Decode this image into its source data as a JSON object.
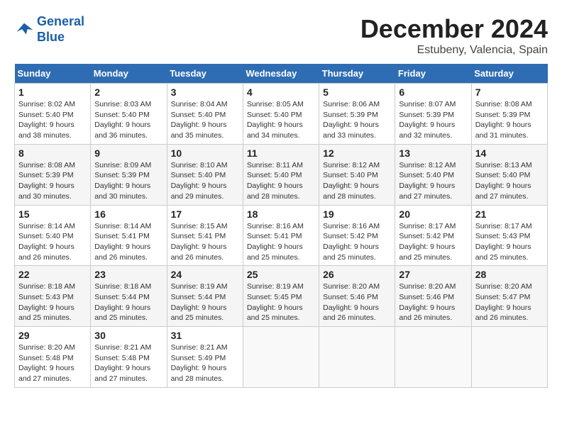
{
  "header": {
    "logo_line1": "General",
    "logo_line2": "Blue",
    "month": "December 2024",
    "location": "Estubeny, Valencia, Spain"
  },
  "days_of_week": [
    "Sunday",
    "Monday",
    "Tuesday",
    "Wednesday",
    "Thursday",
    "Friday",
    "Saturday"
  ],
  "weeks": [
    [
      {
        "day": 1,
        "sunrise": "8:02 AM",
        "sunset": "5:40 PM",
        "daylight": "9 hours and 38 minutes."
      },
      {
        "day": 2,
        "sunrise": "8:03 AM",
        "sunset": "5:40 PM",
        "daylight": "9 hours and 36 minutes."
      },
      {
        "day": 3,
        "sunrise": "8:04 AM",
        "sunset": "5:40 PM",
        "daylight": "9 hours and 35 minutes."
      },
      {
        "day": 4,
        "sunrise": "8:05 AM",
        "sunset": "5:40 PM",
        "daylight": "9 hours and 34 minutes."
      },
      {
        "day": 5,
        "sunrise": "8:06 AM",
        "sunset": "5:39 PM",
        "daylight": "9 hours and 33 minutes."
      },
      {
        "day": 6,
        "sunrise": "8:07 AM",
        "sunset": "5:39 PM",
        "daylight": "9 hours and 32 minutes."
      },
      {
        "day": 7,
        "sunrise": "8:08 AM",
        "sunset": "5:39 PM",
        "daylight": "9 hours and 31 minutes."
      }
    ],
    [
      {
        "day": 8,
        "sunrise": "8:08 AM",
        "sunset": "5:39 PM",
        "daylight": "9 hours and 30 minutes."
      },
      {
        "day": 9,
        "sunrise": "8:09 AM",
        "sunset": "5:39 PM",
        "daylight": "9 hours and 30 minutes."
      },
      {
        "day": 10,
        "sunrise": "8:10 AM",
        "sunset": "5:40 PM",
        "daylight": "9 hours and 29 minutes."
      },
      {
        "day": 11,
        "sunrise": "8:11 AM",
        "sunset": "5:40 PM",
        "daylight": "9 hours and 28 minutes."
      },
      {
        "day": 12,
        "sunrise": "8:12 AM",
        "sunset": "5:40 PM",
        "daylight": "9 hours and 28 minutes."
      },
      {
        "day": 13,
        "sunrise": "8:12 AM",
        "sunset": "5:40 PM",
        "daylight": "9 hours and 27 minutes."
      },
      {
        "day": 14,
        "sunrise": "8:13 AM",
        "sunset": "5:40 PM",
        "daylight": "9 hours and 27 minutes."
      }
    ],
    [
      {
        "day": 15,
        "sunrise": "8:14 AM",
        "sunset": "5:40 PM",
        "daylight": "9 hours and 26 minutes."
      },
      {
        "day": 16,
        "sunrise": "8:14 AM",
        "sunset": "5:41 PM",
        "daylight": "9 hours and 26 minutes."
      },
      {
        "day": 17,
        "sunrise": "8:15 AM",
        "sunset": "5:41 PM",
        "daylight": "9 hours and 26 minutes."
      },
      {
        "day": 18,
        "sunrise": "8:16 AM",
        "sunset": "5:41 PM",
        "daylight": "9 hours and 25 minutes."
      },
      {
        "day": 19,
        "sunrise": "8:16 AM",
        "sunset": "5:42 PM",
        "daylight": "9 hours and 25 minutes."
      },
      {
        "day": 20,
        "sunrise": "8:17 AM",
        "sunset": "5:42 PM",
        "daylight": "9 hours and 25 minutes."
      },
      {
        "day": 21,
        "sunrise": "8:17 AM",
        "sunset": "5:43 PM",
        "daylight": "9 hours and 25 minutes."
      }
    ],
    [
      {
        "day": 22,
        "sunrise": "8:18 AM",
        "sunset": "5:43 PM",
        "daylight": "9 hours and 25 minutes."
      },
      {
        "day": 23,
        "sunrise": "8:18 AM",
        "sunset": "5:44 PM",
        "daylight": "9 hours and 25 minutes."
      },
      {
        "day": 24,
        "sunrise": "8:19 AM",
        "sunset": "5:44 PM",
        "daylight": "9 hours and 25 minutes."
      },
      {
        "day": 25,
        "sunrise": "8:19 AM",
        "sunset": "5:45 PM",
        "daylight": "9 hours and 25 minutes."
      },
      {
        "day": 26,
        "sunrise": "8:20 AM",
        "sunset": "5:46 PM",
        "daylight": "9 hours and 26 minutes."
      },
      {
        "day": 27,
        "sunrise": "8:20 AM",
        "sunset": "5:46 PM",
        "daylight": "9 hours and 26 minutes."
      },
      {
        "day": 28,
        "sunrise": "8:20 AM",
        "sunset": "5:47 PM",
        "daylight": "9 hours and 26 minutes."
      }
    ],
    [
      {
        "day": 29,
        "sunrise": "8:20 AM",
        "sunset": "5:48 PM",
        "daylight": "9 hours and 27 minutes."
      },
      {
        "day": 30,
        "sunrise": "8:21 AM",
        "sunset": "5:48 PM",
        "daylight": "9 hours and 27 minutes."
      },
      {
        "day": 31,
        "sunrise": "8:21 AM",
        "sunset": "5:49 PM",
        "daylight": "9 hours and 28 minutes."
      },
      null,
      null,
      null,
      null
    ]
  ]
}
